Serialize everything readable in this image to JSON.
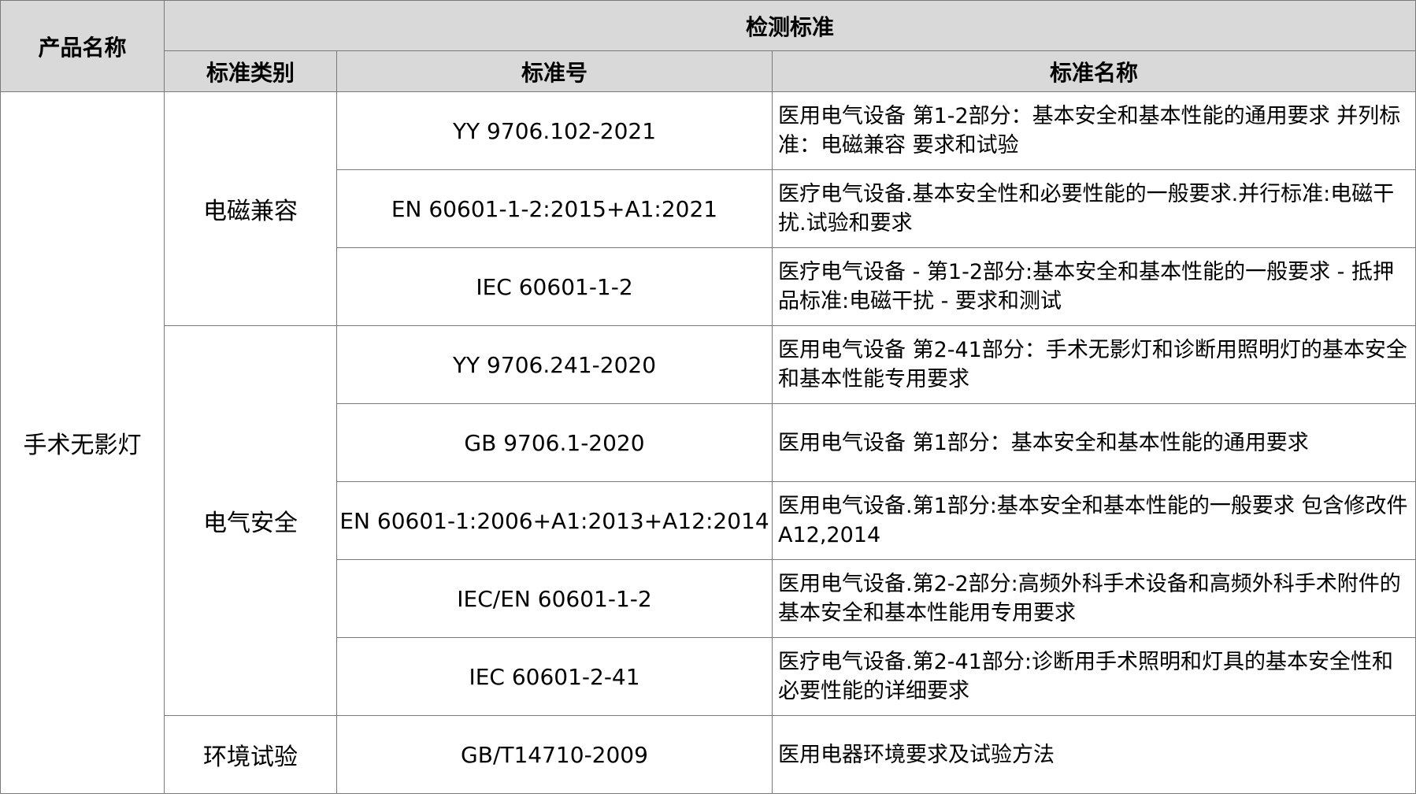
{
  "header": {
    "product_name": "产品名称",
    "test_standard": "检测标准",
    "category": "标准类别",
    "standard_no": "标准号",
    "standard_name": "标准名称"
  },
  "product": "手术无影灯",
  "categories": {
    "emc": "电磁兼容",
    "electrical": "电气安全",
    "environmental": "环境试验"
  },
  "rows": [
    {
      "no": "YY 9706.102-2021",
      "name": "医用电气设备 第1-2部分：基本安全和基本性能的通用要求 并列标准：电磁兼容 要求和试验"
    },
    {
      "no": "EN 60601-1-2:2015+A1:2021",
      "name": "医疗电气设备.基本安全性和必要性能的一般要求.并行标准:电磁干扰.试验和要求"
    },
    {
      "no": "IEC 60601-1-2",
      "name": "医疗电气设备 - 第1-2部分:基本安全和基本性能的一般要求 - 抵押品标准:电磁干扰 - 要求和测试"
    },
    {
      "no": "YY 9706.241-2020",
      "name": "医用电气设备 第2-41部分：手术无影灯和诊断用照明灯的基本安全和基本性能专用要求"
    },
    {
      "no": "GB 9706.1-2020",
      "name": "医用电气设备 第1部分：基本安全和基本性能的通用要求"
    },
    {
      "no": "EN 60601-1:2006+A1:2013+A12:2014",
      "name": "医用电气设备.第1部分:基本安全和基本性能的一般要求 包含修改件A12,2014"
    },
    {
      "no": "IEC/EN 60601-1-2",
      "name": "医用电气设备.第2-2部分:高频外科手术设备和高频外科手术附件的基本安全和基本性能用专用要求"
    },
    {
      "no": "IEC 60601-2-41",
      "name": "医疗电气设备.第2-41部分:诊断用手术照明和灯具的基本安全性和必要性能的详细要求"
    },
    {
      "no": "GB/T14710-2009",
      "name": "医用电器环境要求及试验方法"
    }
  ]
}
